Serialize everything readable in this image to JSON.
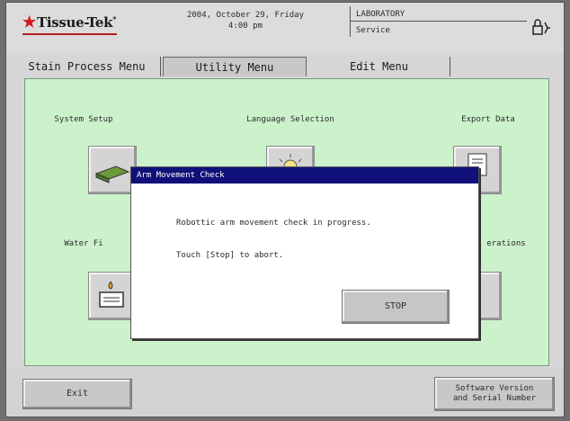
{
  "header": {
    "logo_text": "Tissue-Tek",
    "logo_mark": "★",
    "date_line": "2004, October 29, Friday",
    "time_line": "4:00 pm",
    "location_top": "LABORATORY",
    "location_bottom": "Service",
    "lock_icon": "lock-icon"
  },
  "tabs": [
    {
      "label": "Stain Process Menu",
      "active": false
    },
    {
      "label": "Utility Menu",
      "active": true
    },
    {
      "label": "Edit Menu",
      "active": false
    }
  ],
  "functions": {
    "system_setup": "System Setup",
    "language_selection": "Language Selection",
    "export_data": "Export Data",
    "water_filter": "Water Fi",
    "operations": "erations"
  },
  "dialog": {
    "title": "Arm Movement Check",
    "message_line1": "Robottic arm movement check in progress.",
    "message_line2": "Touch [Stop] to abort.",
    "stop_label": "STOP"
  },
  "bottom": {
    "exit_label": "Exit",
    "software_line1": "Software Version",
    "software_line2": "and Serial Number"
  },
  "colors": {
    "panel_bg": "#ccf2cc",
    "dialog_title_bg": "#10107a",
    "logo_red": "#d21a1a"
  }
}
